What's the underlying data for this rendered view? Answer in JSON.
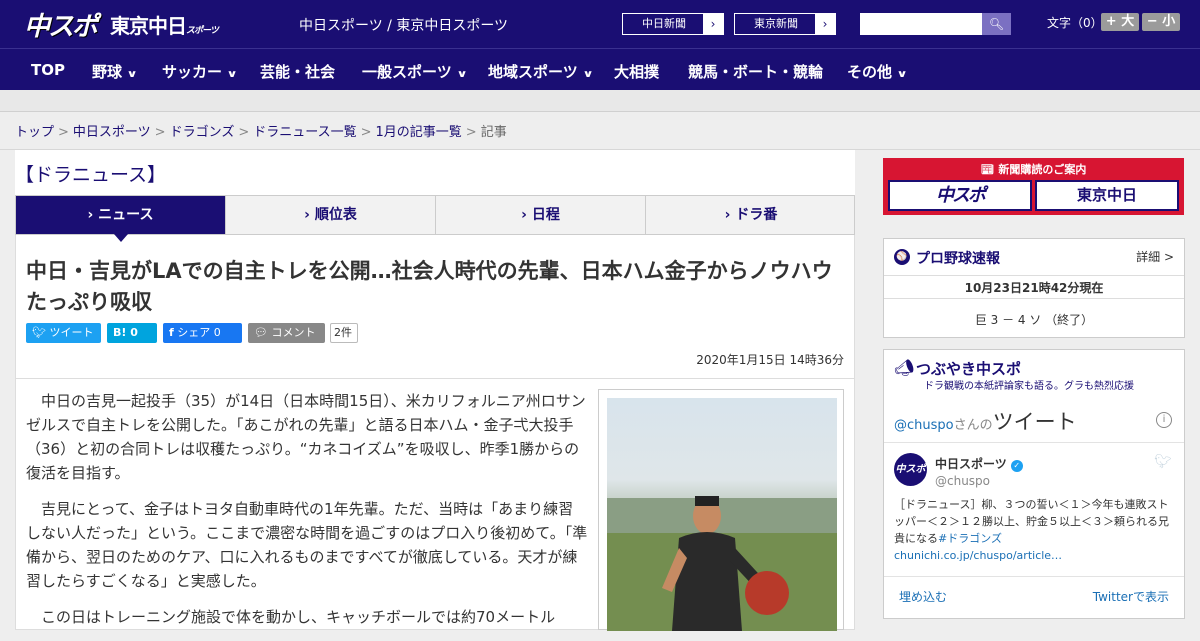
{
  "header": {
    "logo_chuspo": "中スポ",
    "logo_tokyo": "東京中日",
    "logo_tokyo_small": "スポーツ",
    "site_name": "中日スポーツ / 東京中日スポーツ",
    "paper_links": [
      {
        "label": "中日新聞",
        "arrow": "›"
      },
      {
        "label": "東京新聞",
        "arrow": "›"
      }
    ],
    "search_placeholder": "",
    "font_size_label": "文字（0）",
    "font_plus": "+ 大",
    "font_minus": "− 小"
  },
  "nav": [
    {
      "label": "TOP",
      "chevron": ""
    },
    {
      "label": "野球",
      "chevron": "∨"
    },
    {
      "label": "サッカー",
      "chevron": "∨"
    },
    {
      "label": "芸能・社会",
      "chevron": ""
    },
    {
      "label": "一般スポーツ",
      "chevron": "∨"
    },
    {
      "label": "地域スポーツ",
      "chevron": "∨"
    },
    {
      "label": "大相撲",
      "chevron": ""
    },
    {
      "label": "競馬・ボート・競輪",
      "chevron": ""
    },
    {
      "label": "その他",
      "chevron": "∨"
    }
  ],
  "breadcrumb": {
    "items": [
      "トップ",
      "中日スポーツ",
      "ドラゴンズ",
      "ドラニュース一覧",
      "1月の記事一覧"
    ],
    "current": "記事",
    "separator": ">"
  },
  "section_title": "【ドラニュース】",
  "tabs": [
    {
      "label": "› ニュース"
    },
    {
      "label": "› 順位表"
    },
    {
      "label": "› 日程"
    },
    {
      "label": "› ドラ番"
    }
  ],
  "article": {
    "headline": "中日・吉見がLAでの自主トレを公開…社会人時代の先輩、日本ハム金子からノウハウたっぷり吸収",
    "share": {
      "tweet": "ツイート",
      "hatena": "B! 0",
      "facebook": "シェア 0",
      "comment": "コメント",
      "comment_count": "2件"
    },
    "date": "2020年1月15日 14時36分",
    "paragraphs": [
      "中日の吉見一起投手（35）が14日（日本時間15日）、米カリフォルニア州ロサンゼルスで自主トレを公開した。「あこがれの先輩」と語る日本ハム・金子弌大投手（36）と初の合同トレは収穫たっぷり。“カネコイズム”を吸収し、昨季1勝からの復活を目指す。",
      "吉見にとって、金子はトヨタ自動車時代の1年先輩。ただ、当時は「あまり練習しない人だった」という。ここまで濃密な時間を過ごすのはプロ入り後初めて。「準備から、翌日のためのケア、口に入れるものまですべてが徹底している。天才が練習したらすごくなる」と実感した。",
      "この日はトレーニング施設で体を動かし、キャッチボールでは約70メートル"
    ]
  },
  "sidebar": {
    "subscribe": {
      "title": "新聞購読のご案内",
      "button1": "中スポ",
      "button2": "東京中日"
    },
    "scores": {
      "icon": "⚾",
      "title": "プロ野球速報",
      "detail": "詳細 >",
      "time": "10月23日21時42分現在",
      "game": "巨 3 － 4 ソ （終了）"
    },
    "tweets": {
      "title": "つぶやき中スポ",
      "subtitle": "ドラ観戦の本紙評論家も語る。グラも熱烈応援",
      "head_handle": "@chuspo",
      "head_san": "さんの",
      "head_tweet": "ツイート",
      "info": "i",
      "avatar": "中スポ",
      "name": "中日スポーツ",
      "verified": "✓",
      "handle": "@chuspo",
      "text": "［ドラニュース］柳、３つの誓い＜１＞今年も連敗ストッパー＜２＞１２勝以上、貯金５以上＜３＞頼られる兄貴になる",
      "hashtag": "#ドラゴンズ",
      "link": "chunichi.co.jp/chuspo/article…",
      "embed": "埋め込む",
      "view": "Twitterで表示"
    }
  },
  "colors": {
    "brand": "#1a0e73",
    "subscribe_red": "#d71532",
    "twitter": "#1da1f2",
    "facebook": "#1877f2",
    "hatena": "#00a4de"
  }
}
